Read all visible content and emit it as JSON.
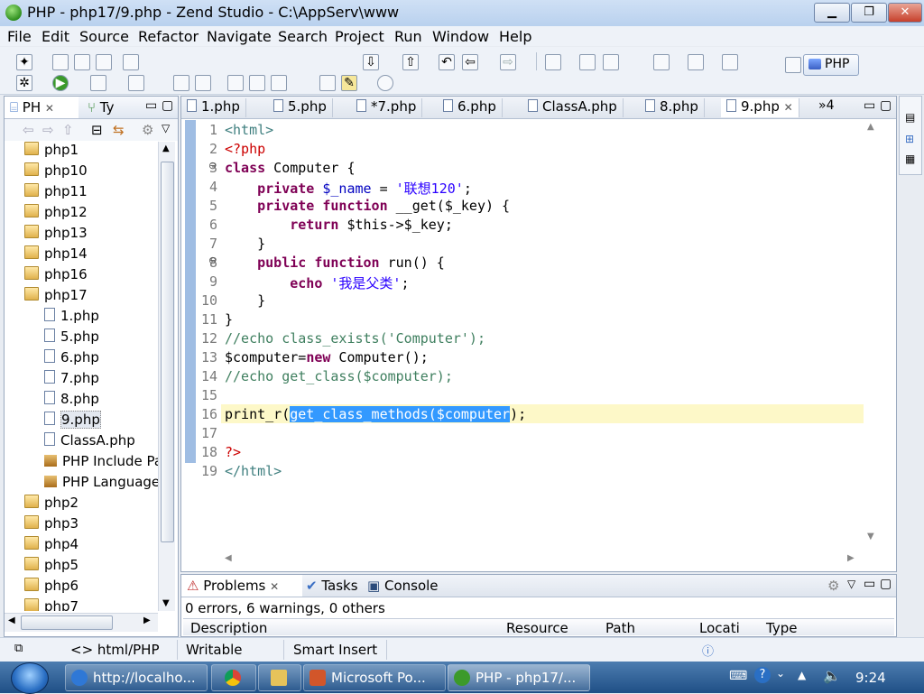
{
  "window": {
    "title": "PHP - php17/9.php - Zend Studio - C:\\AppServ\\www"
  },
  "menu": [
    "File",
    "Edit",
    "Source",
    "Refactor",
    "Navigate",
    "Search",
    "Project",
    "Run",
    "Window",
    "Help"
  ],
  "perspective": {
    "label": "PHP"
  },
  "left_panel": {
    "tabs": [
      "PH",
      "Ty"
    ],
    "tree": [
      {
        "label": "php1",
        "kind": "folder",
        "level": 0
      },
      {
        "label": "php10",
        "kind": "folder",
        "level": 0
      },
      {
        "label": "php11",
        "kind": "folder",
        "level": 0
      },
      {
        "label": "php12",
        "kind": "folder",
        "level": 0
      },
      {
        "label": "php13",
        "kind": "folder",
        "level": 0
      },
      {
        "label": "php14",
        "kind": "folder",
        "level": 0
      },
      {
        "label": "php16",
        "kind": "folder",
        "level": 0
      },
      {
        "label": "php17",
        "kind": "folder",
        "level": 0
      },
      {
        "label": "1.php",
        "kind": "file",
        "level": 1
      },
      {
        "label": "5.php",
        "kind": "file",
        "level": 1
      },
      {
        "label": "6.php",
        "kind": "file",
        "level": 1
      },
      {
        "label": "7.php",
        "kind": "file",
        "level": 1
      },
      {
        "label": "8.php",
        "kind": "file",
        "level": 1
      },
      {
        "label": "9.php",
        "kind": "file",
        "level": 1,
        "selected": true
      },
      {
        "label": "ClassA.php",
        "kind": "file",
        "level": 1
      },
      {
        "label": "PHP Include Pa",
        "kind": "lib",
        "level": 1
      },
      {
        "label": "PHP Language",
        "kind": "lib",
        "level": 1
      },
      {
        "label": "php2",
        "kind": "folder",
        "level": 0
      },
      {
        "label": "php3",
        "kind": "folder",
        "level": 0
      },
      {
        "label": "php4",
        "kind": "folder",
        "level": 0
      },
      {
        "label": "php5",
        "kind": "folder",
        "level": 0
      },
      {
        "label": "php6",
        "kind": "folder",
        "level": 0
      },
      {
        "label": "php7",
        "kind": "folder",
        "level": 0
      }
    ]
  },
  "editor": {
    "tabs": [
      "1.php",
      "5.php",
      "*7.php",
      "6.php",
      "ClassA.php",
      "8.php",
      "9.php"
    ],
    "active_tab": "9.php",
    "overflow": "»4",
    "line_numbers": [
      "1",
      "2",
      "3",
      "4",
      "5",
      "6",
      "7",
      "8",
      "9",
      "10",
      "11",
      "12",
      "13",
      "14",
      "15",
      "16",
      "17",
      "18",
      "19"
    ],
    "fold_markers": {
      "3": "⊖",
      "8": "⊖"
    }
  },
  "bottom_panel": {
    "tabs": [
      "Problems",
      "Tasks",
      "Console"
    ],
    "summary": "0 errors, 6 warnings, 0 others",
    "columns": [
      "Description",
      "Resource",
      "Path",
      "Locati",
      "Type"
    ]
  },
  "statusbar": {
    "mode": "html/PHP",
    "writable": "Writable",
    "insert": "Smart Insert"
  },
  "taskbar": {
    "items": [
      {
        "label": "http://localho...",
        "color": "#2f78d6"
      },
      {
        "label": "",
        "color": "#e0a020"
      },
      {
        "label": "",
        "color": "#c9a64a"
      },
      {
        "label": "Microsoft Po...",
        "color": "#d2562a"
      },
      {
        "label": "PHP - php17/...",
        "color": "#3c9a2a"
      }
    ],
    "clock": "9:24"
  }
}
